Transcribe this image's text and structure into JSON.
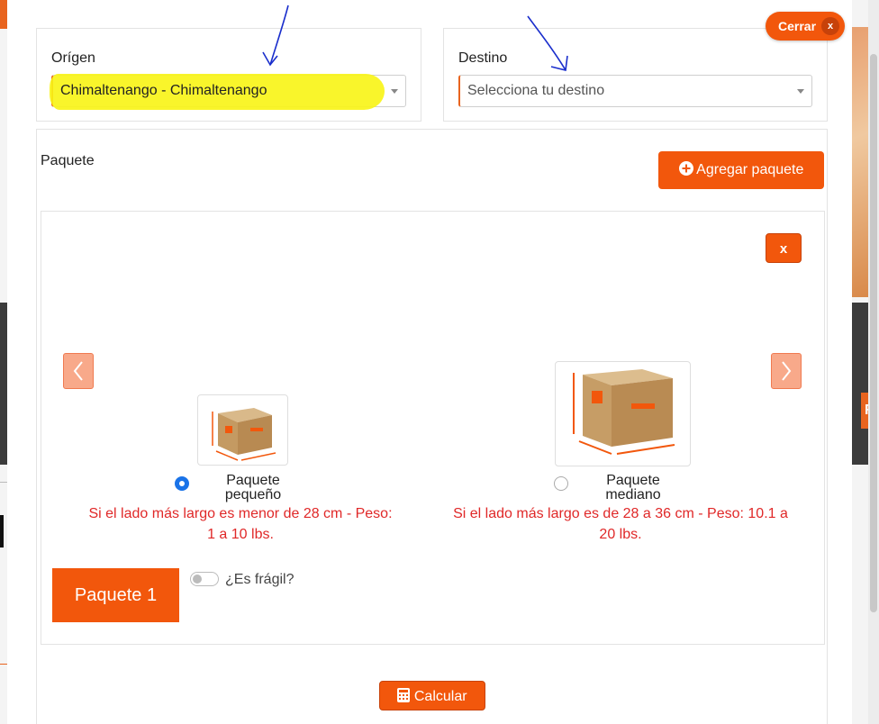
{
  "origin": {
    "label": "Orígen",
    "value": "Chimaltenango - Chimaltenango"
  },
  "destination": {
    "label": "Destino",
    "placeholder": "Selecciona tu destino"
  },
  "close_button": {
    "label": "Cerrar",
    "icon_text": "x"
  },
  "package_section": {
    "label": "Paquete",
    "add_button_label": "Agregar paquete",
    "remove_button_label": "x",
    "fragile_label": "¿Es frágil?",
    "package_tag": "Paquete 1"
  },
  "packages": [
    {
      "name_line1": "Paquete",
      "name_line2": "pequeño",
      "description": "Si el lado más largo es menor de 28 cm - Peso: 1 a 10 lbs.",
      "selected": true
    },
    {
      "name_line1": "Paquete",
      "name_line2": "mediano",
      "description": "Si el lado más largo es de 28 a 36 cm - Peso: 10.1 a 20 lbs.",
      "selected": false
    }
  ],
  "calculate_button": {
    "label": "Calcular"
  },
  "colors": {
    "accent": "#f2570c",
    "error_text": "#e02828",
    "highlight": "#f8f414",
    "annotation": "#1a2ecc"
  },
  "icons": {
    "add": "plus-circle-icon",
    "calculate": "calculator-icon",
    "prev": "chevron-left-icon",
    "next": "chevron-right-icon"
  }
}
